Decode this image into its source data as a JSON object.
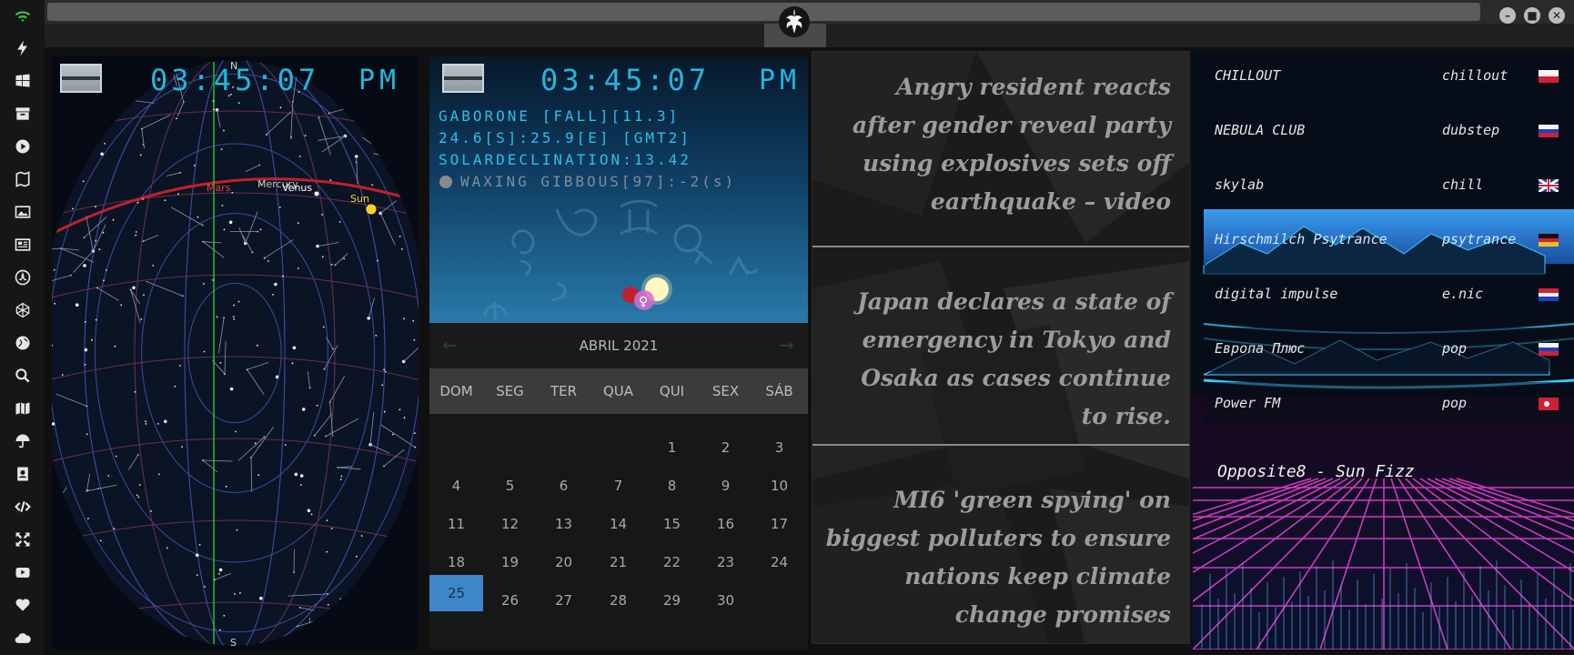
{
  "sidebar": {
    "icons": [
      "wifi-icon",
      "lightning-icon",
      "windows-icon",
      "archive-icon",
      "play-icon",
      "map-book-icon",
      "image-icon",
      "newspaper-icon",
      "nuclear-icon",
      "network-icon",
      "globe-icon",
      "search-icon",
      "map-icon",
      "umbrella-icon",
      "contacts-icon",
      "code-icon",
      "fullscreen-icon",
      "youtube-icon",
      "heart-icon",
      "cloud-icon"
    ]
  },
  "starmap": {
    "clock": "03:45:07",
    "ampm": "PM",
    "compass_n": "N",
    "compass_s": "S",
    "planets": [
      "Mars",
      "Mercury",
      "Venus",
      "Sun"
    ]
  },
  "worldclock": {
    "clock": "03:45:07",
    "ampm": "PM",
    "location_line": "GABORONE [FALL][11.3]",
    "coords_line": "24.6[S]:25.9[E] [GMT2]",
    "declination_line": "SOLARDECLINATION:13.42",
    "moon_line": "WAXING GIBBOUS[97]:-2(s)"
  },
  "calendar": {
    "month_label": "ABRIL 2021",
    "prev": "←",
    "next": "→",
    "weekdays": [
      "DOM",
      "SEG",
      "TER",
      "QUA",
      "QUI",
      "SEX",
      "SÁB"
    ],
    "first_weekday_index": 4,
    "days_in_month": 30,
    "today": 25
  },
  "news": {
    "items": [
      "Angry resident reacts after gender reveal party using explosives sets off earthquake – video",
      "Japan declares a state of emergency in Tokyo and Osaka as cases continue to rise.",
      "MI6 'green spying' on biggest polluters to ensure nations keep climate change promises"
    ]
  },
  "radio": {
    "stations": [
      {
        "name": "CHILLOUT",
        "genre": "chillout",
        "flag": "pl"
      },
      {
        "name": "NEBULA CLUB",
        "genre": "dubstep",
        "flag": "ru"
      },
      {
        "name": "skylab",
        "genre": "chill",
        "flag": "gb"
      },
      {
        "name": "Hirschmilch Psytrance",
        "genre": "psytrance",
        "flag": "de"
      },
      {
        "name": "digital impulse",
        "genre": "e.nic",
        "flag": "hr"
      },
      {
        "name": "Европа Плюс",
        "genre": "pop",
        "flag": "ru"
      },
      {
        "name": "Power FM",
        "genre": "pop",
        "flag": "tr"
      }
    ],
    "selected_index": 3,
    "now_playing": "Opposite8 - Sun Fizz"
  },
  "colors": {
    "clock_cyan": "#22b7dc",
    "calendar_today": "#3d87c9",
    "ecliptic_red": "#c0202a",
    "meridian_green": "#22c030",
    "grid_neon_pink": "#e040d0",
    "grid_neon_cyan": "#30c8ff"
  }
}
